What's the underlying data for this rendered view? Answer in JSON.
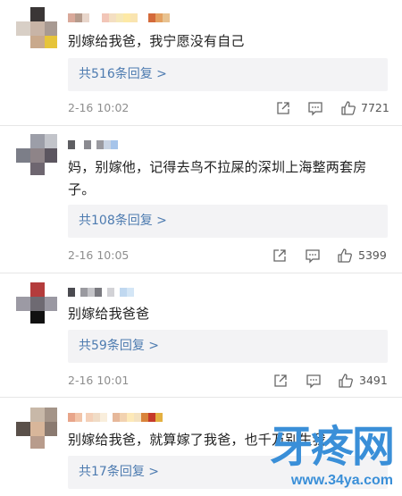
{
  "comments": [
    {
      "text": "别嫁给我爸，我宁愿没有自己",
      "reply_label": "共516条回复 >",
      "time": "2-16 10:02",
      "likes": "7721"
    },
    {
      "text": "妈，别嫁他，记得去鸟不拉屎的深圳上海整两套房子。",
      "reply_label": "共108条回复 >",
      "time": "2-16 10:05",
      "likes": "5399"
    },
    {
      "text": "别嫁给我爸爸",
      "reply_label": "共59条回复 >",
      "time": "2-16 10:01",
      "likes": "3491"
    },
    {
      "text": "别嫁给我爸，就算嫁了我爸，也千万别生我",
      "reply_label": "共17条回复 >"
    }
  ],
  "icons": {
    "share": "share-icon",
    "comment": "comment-icon",
    "like": "thumbs-up-icon"
  },
  "watermark": {
    "main": "牙疼网",
    "url": "www.34ya.com"
  },
  "colors": {
    "link": "#4d7bb0",
    "watermark": "#3a8fd8"
  }
}
